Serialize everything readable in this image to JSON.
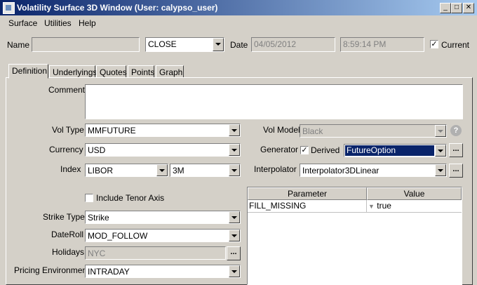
{
  "window": {
    "title": "Volatility Surface 3D Window (User: calypso_user)"
  },
  "menu": [
    "Surface",
    "Utilities",
    "Help"
  ],
  "header": {
    "name_label": "Name",
    "name_value": "",
    "type_value": "CLOSE",
    "date_label": "Date",
    "date_value": "04/05/2012",
    "time_value": "8:59:14 PM",
    "current_label": "Current",
    "current_checked": true
  },
  "tabs": [
    "Definition",
    "Underlyings",
    "Quotes",
    "Points",
    "Graph"
  ],
  "definition": {
    "comment_label": "Comment",
    "comment_value": "",
    "vol_type_label": "Vol Type",
    "vol_type_value": "MMFUTURE",
    "currency_label": "Currency",
    "currency_value": "USD",
    "index_label": "Index",
    "index_value": "LIBOR",
    "tenor_value": "3M",
    "include_tenor_label": "Include Tenor Axis",
    "include_tenor_checked": false,
    "strike_type_label": "Strike Type",
    "strike_type_value": "Strike",
    "dateroll_label": "DateRoll",
    "dateroll_value": "MOD_FOLLOW",
    "holidays_label": "Holidays",
    "holidays_value": "NYC",
    "pricing_env_label": "Pricing Environment",
    "pricing_env_value": "INTRADAY",
    "vol_model_label": "Vol Model",
    "vol_model_value": "Black",
    "generator_label": "Generator",
    "derived_label": "Derived",
    "derived_checked": true,
    "generator_value": "FutureOption",
    "interpolator_label": "Interpolator",
    "interpolator_value": "Interpolator3DLinear"
  },
  "params_table": {
    "columns": [
      "Parameter",
      "Value"
    ],
    "rows": [
      {
        "parameter": "FILL_MISSING",
        "value": "true"
      }
    ]
  },
  "colors": {
    "selection": "#0a246a",
    "title_start": "#0a246a",
    "title_end": "#a6caf0",
    "face": "#d4d0c8"
  }
}
